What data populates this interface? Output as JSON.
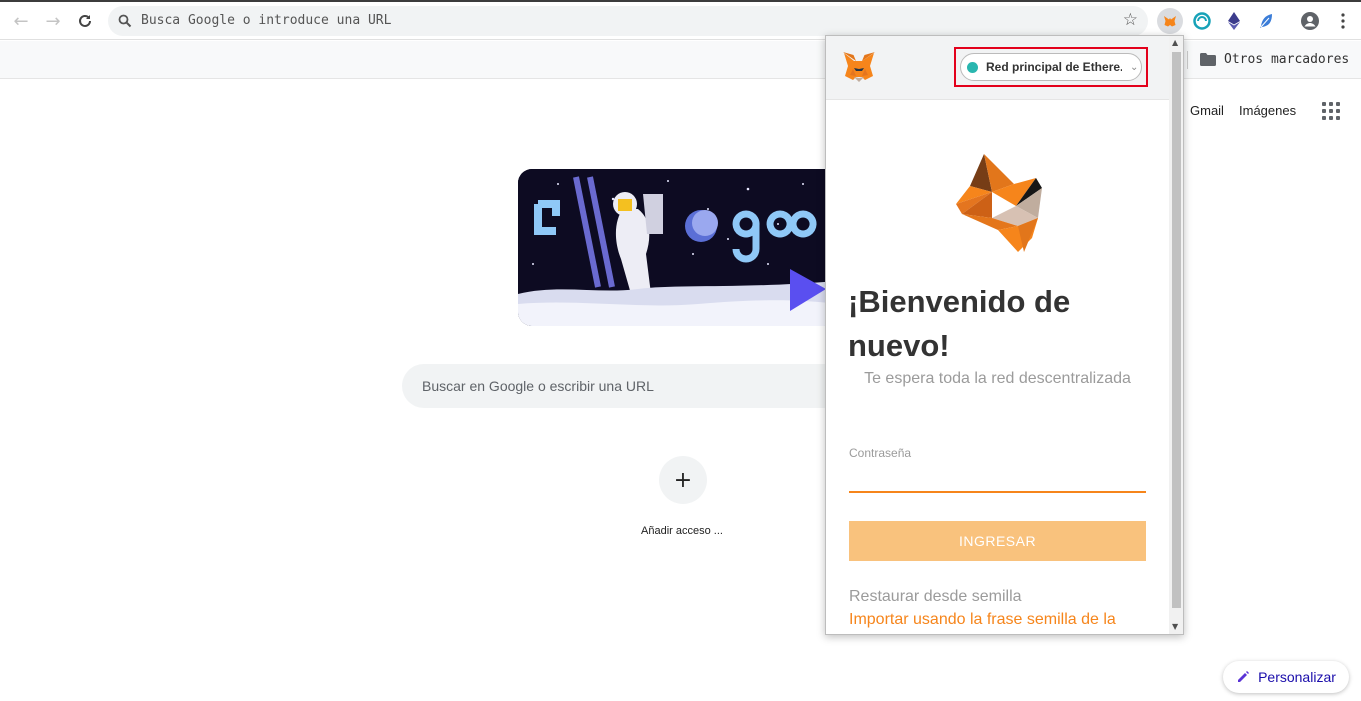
{
  "browser": {
    "omnibox_placeholder": "Busca Google o introduce una URL",
    "bookmarks": {
      "other_folder": "Otros marcadores"
    },
    "extensions": [
      "metamask-icon",
      "teal-circle-icon",
      "ethereum-icon",
      "feather-icon"
    ]
  },
  "newtab": {
    "links": {
      "gmail": "Gmail",
      "images": "Imágenes"
    },
    "search_placeholder": "Buscar en Google o escribir una URL",
    "shortcut_label": "Añadir acceso ...",
    "customize": "Personalizar"
  },
  "metamask": {
    "network": "Red principal de Ethere...",
    "network_color": "#29b6af",
    "title": "¡Bienvenido de nuevo!",
    "subtitle": "Te espera toda la red descentralizada",
    "password_label": "Contraseña",
    "unlock_button": "INGRESAR",
    "restore": "Restaurar desde semilla",
    "import": "Importar usando la frase semilla de la cuenta"
  },
  "colors": {
    "accent_orange": "#f6851b",
    "button_disabled": "#f9c27d",
    "highlight_border": "#e3001b"
  }
}
